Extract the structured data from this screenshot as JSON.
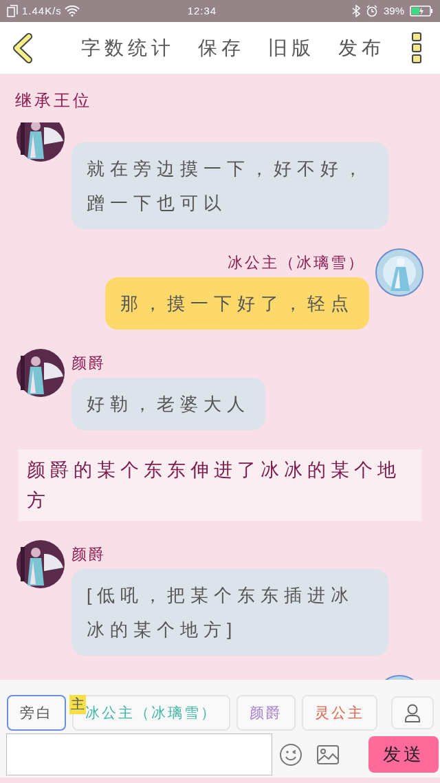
{
  "status_bar": {
    "speed": "1.44K/s",
    "time": "12:34",
    "battery": "39%"
  },
  "toolbar": {
    "actions": [
      "字数统计",
      "保存",
      "旧版",
      "发布"
    ]
  },
  "chapter_title": "继承王位",
  "messages": [
    {
      "kind": "left",
      "text": "就在旁边摸一下，好不好，蹭一下也可以"
    },
    {
      "kind": "right",
      "name": "冰公主（冰璃雪）",
      "text": "那，摸一下好了，轻点"
    },
    {
      "kind": "left",
      "name": "颜爵",
      "text": "好勒，老婆大人"
    },
    {
      "kind": "narration",
      "text": "颜爵的某个东东伸进了冰冰的某个地方"
    },
    {
      "kind": "left",
      "name": "颜爵",
      "text": "[低吼，把某个东东插进冰冰的某个地方]"
    },
    {
      "kind": "right"
    }
  ],
  "roles": [
    {
      "label": "旁白",
      "selected": true,
      "color": "#555555"
    },
    {
      "label": "冰公主（冰璃雪）",
      "selected": false,
      "color": "#3fb5a5",
      "badge": "主"
    },
    {
      "label": "颜爵",
      "selected": false,
      "color": "#a47ccf"
    },
    {
      "label": "灵公主",
      "selected": false,
      "color": "#e0644e"
    }
  ],
  "send_button": "发送"
}
